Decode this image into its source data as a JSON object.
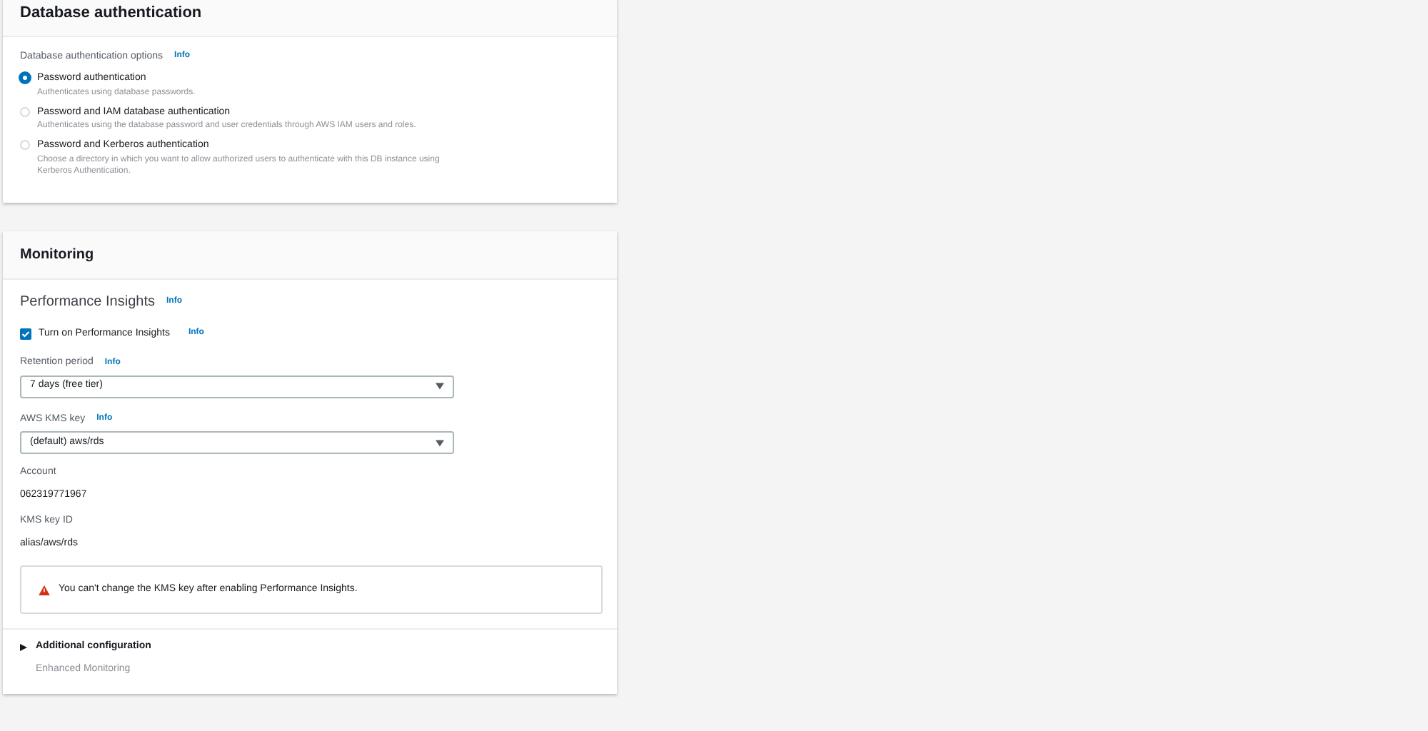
{
  "auth_panel": {
    "title": "Database authentication",
    "options_label": "Database authentication options",
    "info": "Info",
    "options": [
      {
        "label": "Password authentication",
        "description": "Authenticates using database passwords.",
        "selected": true
      },
      {
        "label": "Password and IAM database authentication",
        "description": "Authenticates using the database password and user credentials through AWS IAM users and roles.",
        "selected": false
      },
      {
        "label": "Password and Kerberos authentication",
        "description": "Choose a directory in which you want to allow authorized users to authenticate with this DB instance using Kerberos Authentication.",
        "selected": false
      }
    ]
  },
  "monitoring_panel": {
    "title": "Monitoring",
    "subtitle": "Performance Insights",
    "subtitle_info": "Info",
    "checkbox": {
      "label": "Turn on Performance Insights",
      "info": "Info",
      "checked": true
    },
    "selects": [
      {
        "label": "Retention period",
        "info": "Info",
        "value": "7 days (free tier)"
      },
      {
        "label": "AWS KMS key",
        "info": "Info",
        "value": "(default) aws/rds"
      }
    ],
    "values": [
      {
        "label": "Account",
        "value": "062319771967"
      },
      {
        "label": "KMS key ID",
        "value": "alias/aws/rds"
      }
    ],
    "warning": "You can't change the KMS key after enabling Performance Insights.",
    "expander": {
      "label": "Additional configuration",
      "expanded": false,
      "summary": "Enhanced Monitoring"
    }
  }
}
